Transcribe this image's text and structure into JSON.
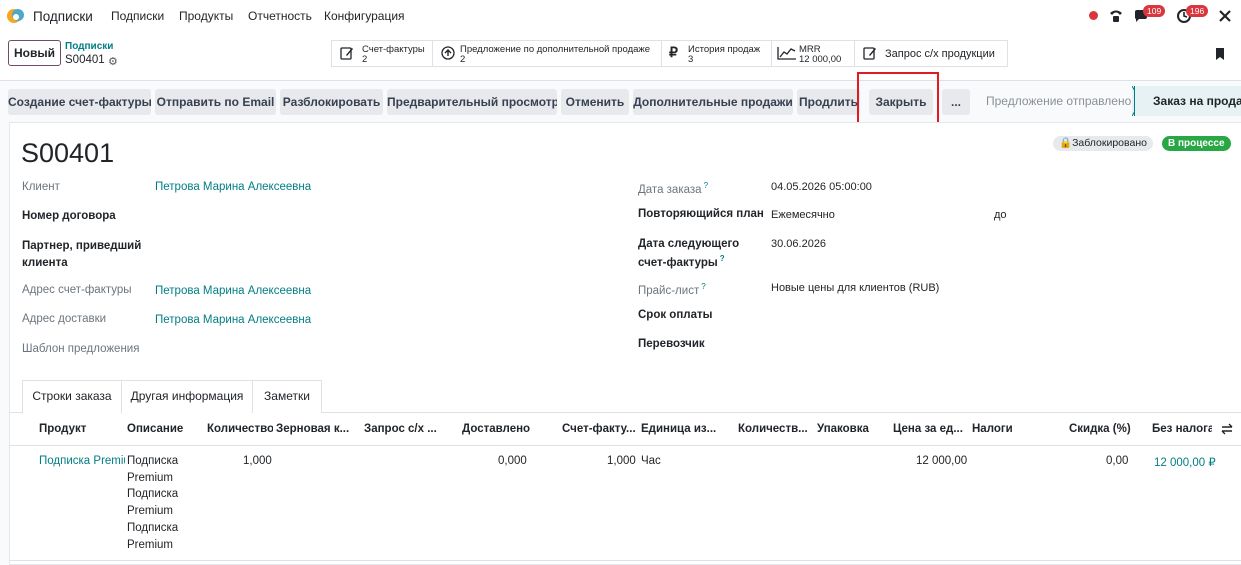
{
  "navbar": {
    "app_name": "Подписки",
    "menu": [
      "Подписки",
      "Продукты",
      "Отчетность",
      "Конфигурация"
    ],
    "messages_count": "109",
    "activities_count": "196"
  },
  "control_panel": {
    "new_button": "Новый",
    "breadcrumb_parent": "Подписки",
    "breadcrumb_current": "S00401",
    "smart_buttons": [
      {
        "title": "Счет-фактуры",
        "value": "2",
        "icon": "pencil-square-icon"
      },
      {
        "title": "Предложение по дополнительной продаже",
        "value": "2",
        "icon": "arrow-up-circle-icon"
      },
      {
        "title": "История продаж",
        "value": "3",
        "icon": "ruble-icon"
      },
      {
        "title": "MRR",
        "value": "12 000,00",
        "icon": "area-chart-icon"
      },
      {
        "title": "Запрос с/х продукции",
        "value": "",
        "icon": "pencil-square-icon"
      }
    ]
  },
  "actions": {
    "buttons": [
      "Создание счет-фактуры",
      "Отправить по Email",
      "Разблокировать",
      "Предварительный просмотр",
      "Отменить",
      "Дополнительные продажи",
      "Продлить",
      "Закрыть",
      "..."
    ],
    "stage_previous": "Предложение отправлено",
    "stage_current": "Заказ на продажу"
  },
  "record": {
    "name": "S00401",
    "locked_label": "Заблокировано",
    "status": "В процессе",
    "left_fields": [
      {
        "label": "Клиент",
        "value": "Петрова Марина Алексеевна"
      },
      {
        "label": "Номер договора",
        "value": ""
      },
      {
        "label": "Партнер, приведший",
        "label2": "клиента",
        "value": ""
      },
      {
        "label": "Адрес счет-фактуры",
        "value": "Петрова Марина Алексеевна"
      },
      {
        "label": "Адрес доставки",
        "value": "Петрова Марина Алексеевна"
      },
      {
        "label": "Шаблон предложения",
        "value": ""
      }
    ],
    "right_fields": [
      {
        "label": "Дата заказа",
        "value": "04.05.2026 05:00:00"
      },
      {
        "label": "Повторяющийся план",
        "value": "Ежемесячно",
        "extra": "до"
      },
      {
        "label": "Дата следующего",
        "label2": "счет-фактуры",
        "value": "30.06.2026"
      },
      {
        "label": "Прайс-лист",
        "value": "Новые цены для клиентов (RUB)"
      },
      {
        "label": "Срок оплаты",
        "value": ""
      },
      {
        "label": "Перевозчик",
        "value": ""
      }
    ]
  },
  "tabs": [
    "Строки заказа",
    "Другая информация",
    "Заметки"
  ],
  "order_lines": {
    "columns": [
      "Продукт",
      "Описание",
      "Количество",
      "Зерновая к...",
      "Запрос с/х ...",
      "Доставлено",
      "Счет-факту...",
      "Единица из...",
      "Количеств...",
      "Упаковка",
      "Цена за ед...",
      "Налоги",
      "Скидка (%)",
      "Без налога."
    ],
    "rows": [
      {
        "product": "Подписка Premium",
        "description": [
          "Подписка",
          "Premium",
          "Подписка",
          "Premium",
          "Подписка",
          "Premium"
        ],
        "quantity": "1,000",
        "delivered": "0,000",
        "invoiced": "1,000",
        "uom": "Час",
        "price": "12 000,00",
        "discount": "0,00",
        "subtotal": "12 000,00 ₽"
      }
    ]
  }
}
